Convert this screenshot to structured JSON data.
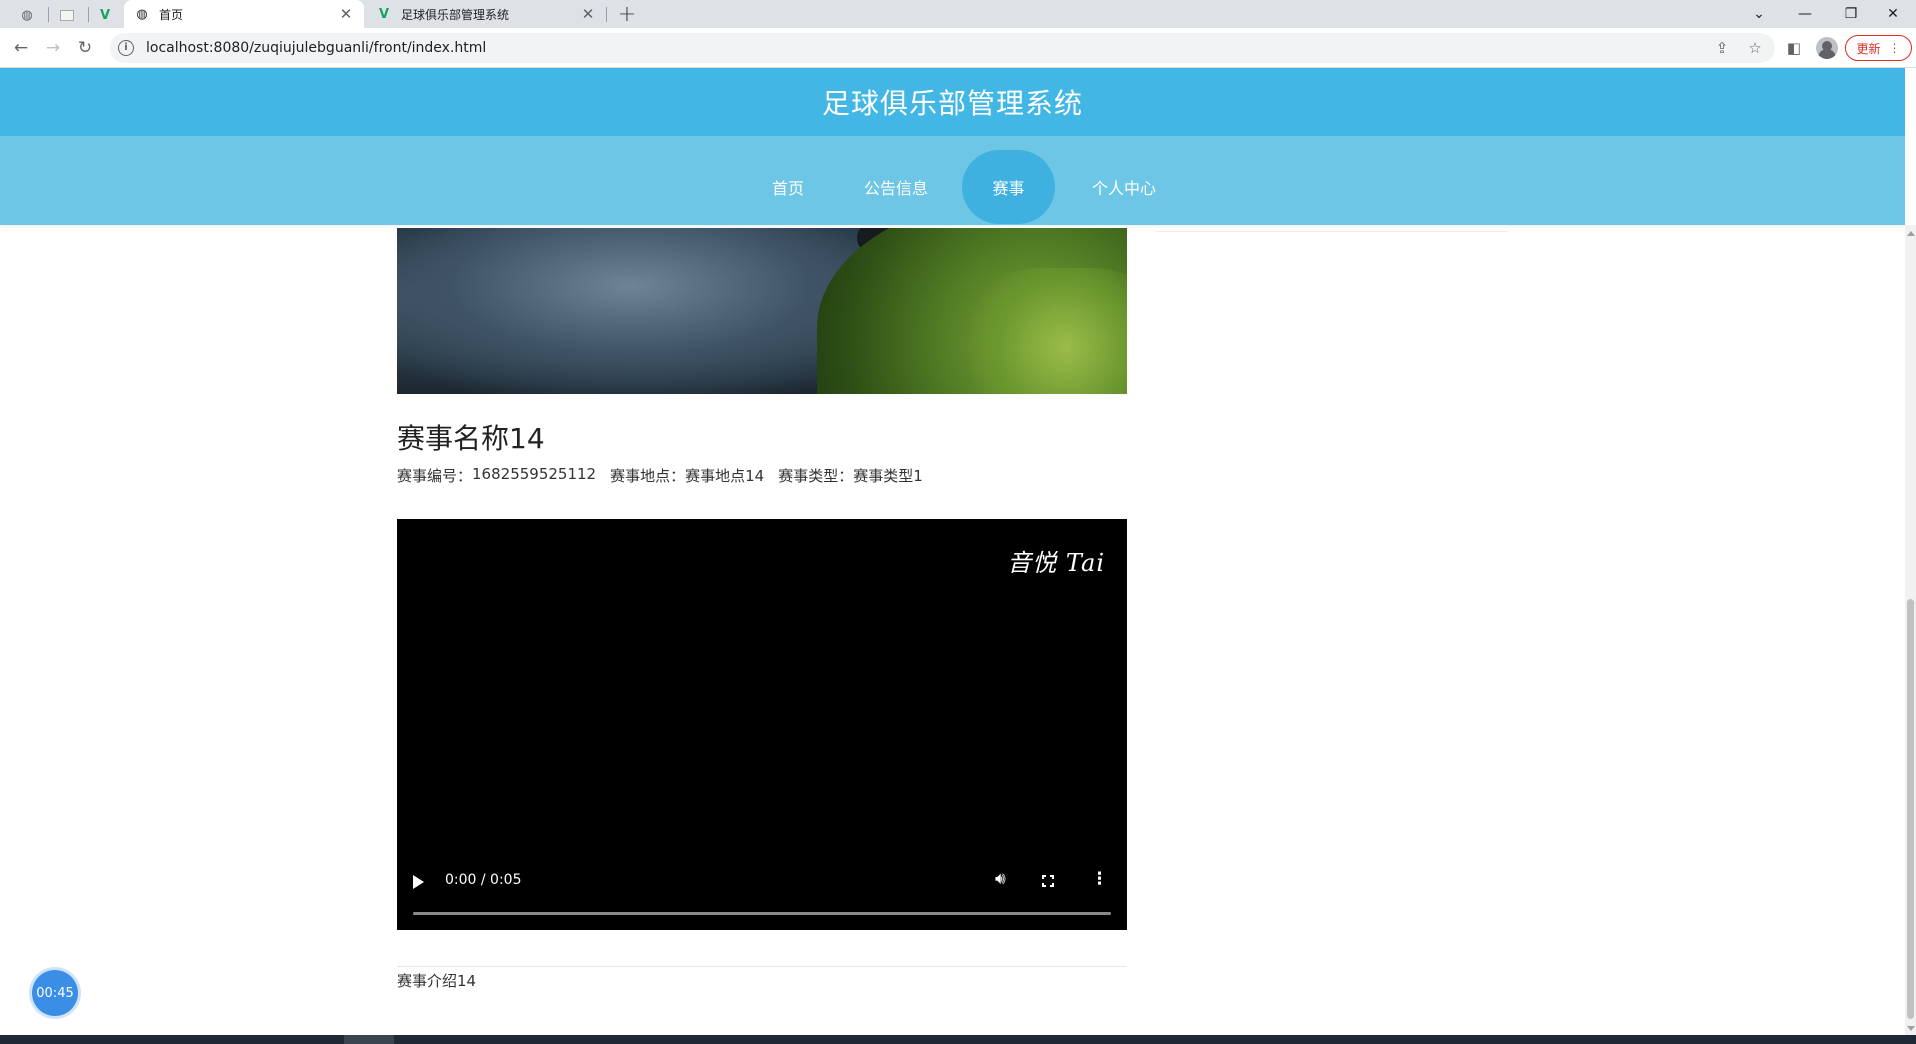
{
  "browser": {
    "tabs": [
      {
        "title": "首页",
        "active": true
      },
      {
        "title": "足球俱乐部管理系统",
        "active": false
      }
    ],
    "url": "localhost:8080/zuqiujulebguanli/front/index.html",
    "update_label": "更新"
  },
  "site": {
    "title": "足球俱乐部管理系统",
    "nav": [
      "首页",
      "公告信息",
      "赛事",
      "个人中心"
    ],
    "active_nav": "赛事"
  },
  "match": {
    "name": "赛事名称14",
    "meta": [
      {
        "label": "赛事编号：",
        "value": "1682559525112"
      },
      {
        "label": "赛事地点：",
        "value": "赛事地点14"
      },
      {
        "label": "赛事类型：",
        "value": "赛事类型1"
      }
    ],
    "intro": "赛事介绍14"
  },
  "video": {
    "watermark": "音悦 Tai",
    "time": "0:00 / 0:05",
    "progress": 0
  },
  "timer": "00:45"
}
